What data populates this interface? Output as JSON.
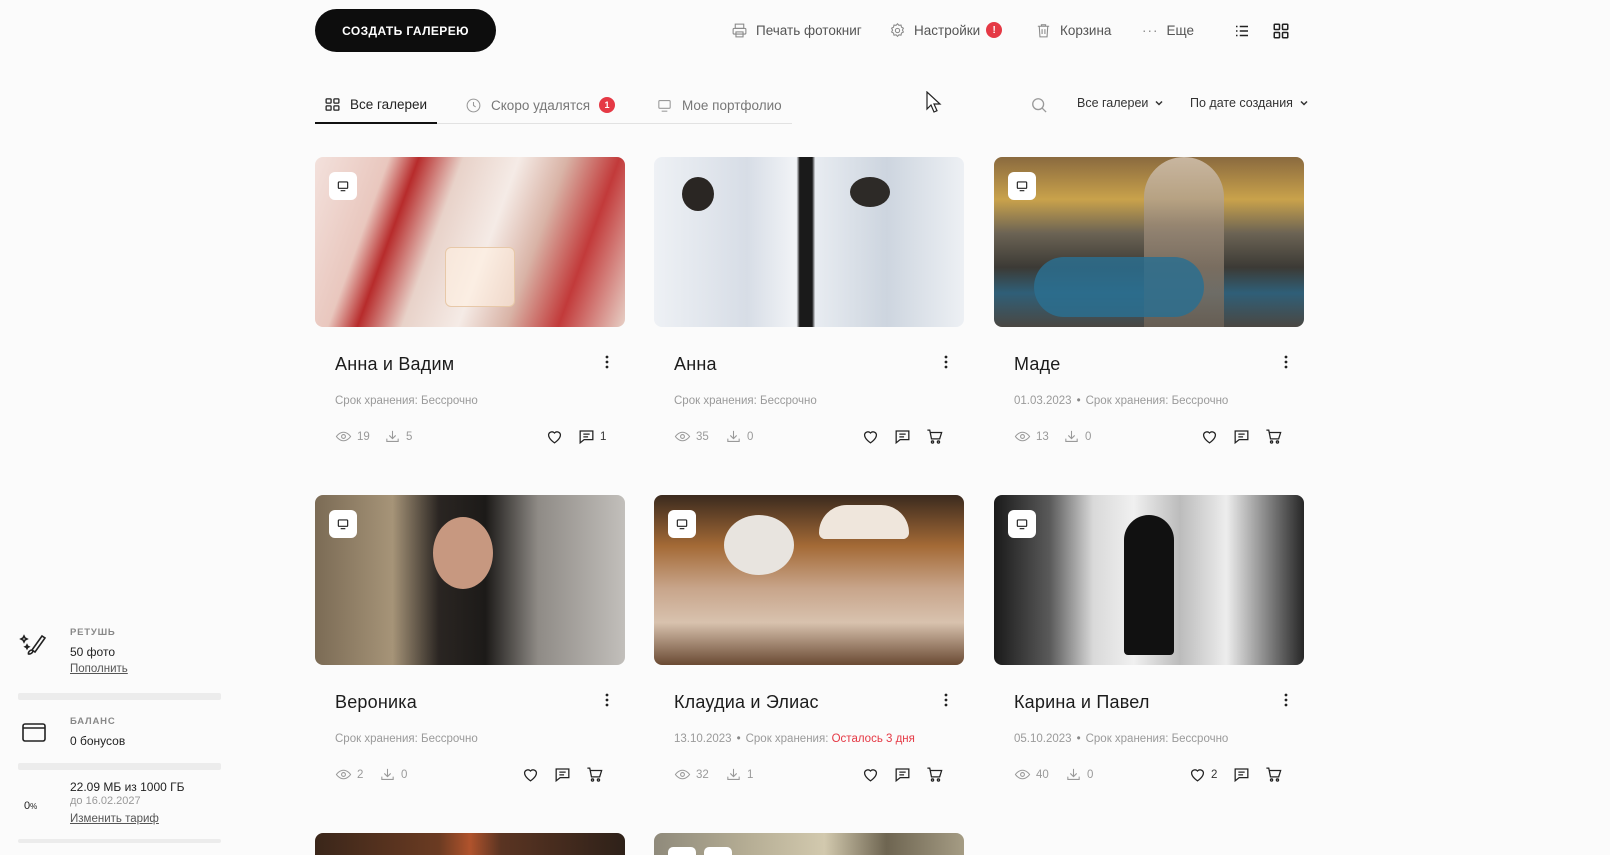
{
  "toolbar": {
    "create_label": "СОЗДАТЬ ГАЛЕРЕЮ",
    "print_label": "Печать фотокниг",
    "settings_label": "Настройки",
    "settings_badge": "!",
    "trash_label": "Корзина",
    "more_label": "Еще",
    "list_view_icon": "list-icon",
    "grid_view_icon": "grid-icon"
  },
  "tabs": [
    {
      "label": "Все галереи",
      "icon": "grid-icon",
      "active": true
    },
    {
      "label": "Скоро удалятся",
      "icon": "clock-icon",
      "badge": "1"
    },
    {
      "label": "Мое портфолио",
      "icon": "monitor-icon"
    }
  ],
  "filters": {
    "galleries": "Все галереи",
    "sort": "По дате создания"
  },
  "galleries": [
    {
      "title": "Анна и Вадим",
      "date": "",
      "storage_label": "Срок хранения:",
      "storage": "Бессрочно",
      "views": "19",
      "downloads": "5",
      "likes": "",
      "comments": "1",
      "has_cart": false
    },
    {
      "title": "Анна",
      "date": "",
      "storage_label": "Срок хранения:",
      "storage": "Бессрочно",
      "views": "35",
      "downloads": "0",
      "likes": "",
      "comments": "",
      "has_cart": true
    },
    {
      "title": "Маде",
      "date": "01.03.2023",
      "storage_label": "Срок хранения:",
      "storage": "Бессрочно",
      "views": "13",
      "downloads": "0",
      "likes": "",
      "comments": "",
      "has_cart": true
    },
    {
      "title": "Вероника",
      "date": "",
      "storage_label": "Срок хранения:",
      "storage": "Бессрочно",
      "views": "2",
      "downloads": "0",
      "likes": "",
      "comments": "",
      "has_cart": true
    },
    {
      "title": "Клаудиа и Элиас",
      "date": "13.10.2023",
      "storage_label": "Срок хранения:",
      "storage": "Осталось 3 дня",
      "storage_warning": true,
      "views": "32",
      "downloads": "1",
      "likes": "",
      "comments": "",
      "has_cart": true
    },
    {
      "title": "Карина и Павел",
      "date": "05.10.2023",
      "storage_label": "Срок хранения:",
      "storage": "Бессрочно",
      "views": "40",
      "downloads": "0",
      "likes": "2",
      "comments": "",
      "has_cart": true
    }
  ],
  "sidebar": {
    "retouch": {
      "label": "РЕТУШЬ",
      "value": "50 фото",
      "link": "Пополнить"
    },
    "balance": {
      "label": "БАЛАНС",
      "value": "0 бонусов"
    },
    "storage": {
      "percent": "0",
      "percent_unit": "%",
      "usage": "22.09 МБ из 1000 ГБ",
      "until": "до 16.02.2027",
      "link": "Изменить тариф"
    }
  },
  "colors": {
    "accent": "#0d0d0d",
    "badge": "#e53945",
    "warning": "#e53945",
    "muted": "#9a9a9a"
  }
}
